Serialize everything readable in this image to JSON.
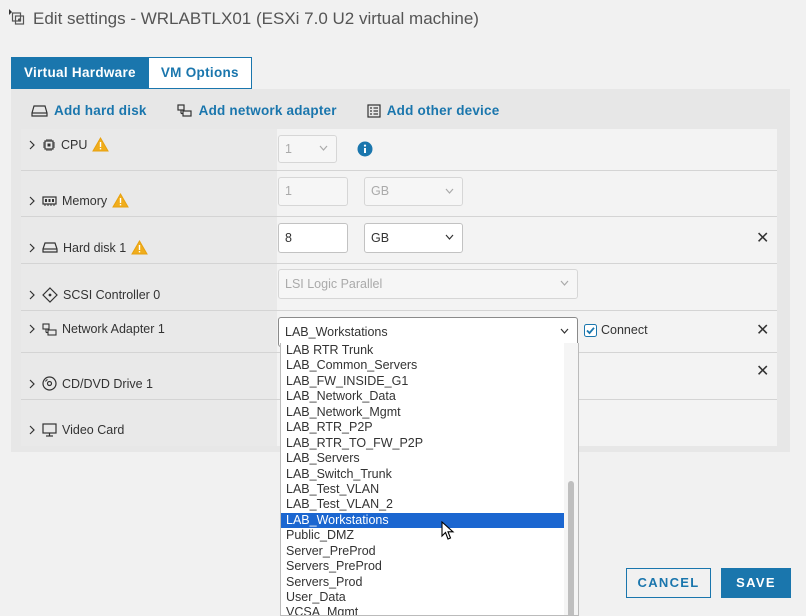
{
  "title": "Edit settings - WRLABTLX01 (ESXi 7.0 U2 virtual machine)",
  "tabs": [
    {
      "label": "Virtual Hardware",
      "active": true
    },
    {
      "label": "VM Options",
      "active": false
    }
  ],
  "toolbar": {
    "add_hard_disk": "Add hard disk",
    "add_network_adapter": "Add network adapter",
    "add_other_device": "Add other device"
  },
  "rows": {
    "cpu": {
      "label": "CPU",
      "value": "1",
      "warning": true
    },
    "memory": {
      "label": "Memory",
      "value": "1",
      "unit": "GB",
      "warning": true
    },
    "hard_disk": {
      "label": "Hard disk 1",
      "value": "8",
      "unit": "GB",
      "warning": true
    },
    "scsi": {
      "label": "SCSI Controller 0",
      "value": "LSI Logic Parallel"
    },
    "network": {
      "label": "Network Adapter 1",
      "value": "LAB_Workstations",
      "connect_label": "Connect",
      "connected": true
    },
    "cdrom": {
      "label": "CD/DVD Drive 1"
    },
    "video": {
      "label": "Video Card"
    }
  },
  "network_options": [
    "LAB RTR Trunk",
    "LAB_Common_Servers",
    "LAB_FW_INSIDE_G1",
    "LAB_Network_Data",
    "LAB_Network_Mgmt",
    "LAB_RTR_P2P",
    "LAB_RTR_TO_FW_P2P",
    "LAB_Servers",
    "LAB_Switch_Trunk",
    "LAB_Test_VLAN",
    "LAB_Test_VLAN_2",
    "LAB_Workstations",
    "Public_DMZ",
    "Server_PreProd",
    "Servers_PreProd",
    "Servers_Prod",
    "User_Data",
    "VCSA_Mgmt"
  ],
  "selected_option": "LAB_Workstations",
  "buttons": {
    "cancel": "CANCEL",
    "save": "SAVE"
  },
  "colors": {
    "accent": "#1a76ad",
    "selection": "#1b66d0",
    "warning": "#f0ad1c"
  }
}
